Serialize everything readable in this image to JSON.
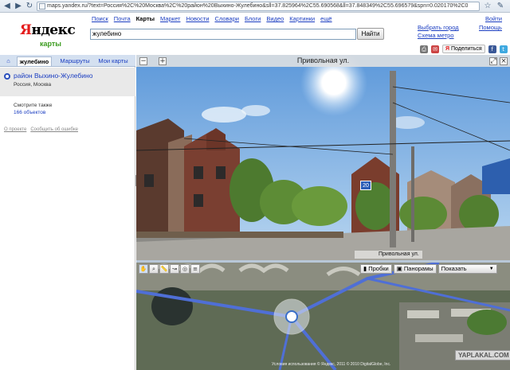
{
  "browser": {
    "url": "maps.yandex.ru/?text=Россия%2C%20Москва%2C%20район%20Выхино-Жулебино&sll=37.825964%2C55.690568&ll=37.848349%2C55.696579&spn=0.020170%2C0"
  },
  "header": {
    "logo_text_red": "Я",
    "logo_text_rest": "ндекс",
    "logo_sub": "карты",
    "services": [
      {
        "label": "Поиск",
        "active": false
      },
      {
        "label": "Почта",
        "active": false
      },
      {
        "label": "Карты",
        "active": true
      },
      {
        "label": "Маркет",
        "active": false
      },
      {
        "label": "Новости",
        "active": false
      },
      {
        "label": "Словари",
        "active": false
      },
      {
        "label": "Блоги",
        "active": false
      },
      {
        "label": "Видео",
        "active": false
      },
      {
        "label": "Картинки",
        "active": false
      },
      {
        "label": "ещё",
        "active": false
      }
    ],
    "search_value": "жулебино",
    "find_button": "Найти",
    "choose_city": "Выбрать город",
    "metro_map": "Схема метро",
    "login": "Войти",
    "help": "Помощь",
    "share_label": "Поделиться"
  },
  "left_panel": {
    "tabs": [
      {
        "label": "жулебино",
        "active": true
      },
      {
        "label": "Маршруты",
        "active": false
      },
      {
        "label": "Мои карты",
        "active": false
      }
    ],
    "result_title": "район Выхино-Жулебино",
    "result_sub": "Россия, Москва",
    "see_also": "Смотрите также",
    "objects_link": "166 объектов",
    "about_project": "О проекте",
    "report_error": "Сообщить об ошибке"
  },
  "panorama": {
    "title": "Привольная ул.",
    "street_label": "Привольная ул.",
    "house_number": "20"
  },
  "map": {
    "tools": [
      "hand",
      "zoom",
      "ruler",
      "route",
      "panorama",
      "layers"
    ],
    "traffic_button": "Пробки",
    "panoramas_button": "Панорамы",
    "show_button": "Показать",
    "copyright": "Условия использования © Яндекс, 2011 © 2010 DigitalGlobe, Inc.",
    "watermark": "YAPLAKAL.COM"
  },
  "colors": {
    "link": "#1a3dc1",
    "logo_red": "#e41b1b",
    "maps_green": "#3b9b1f",
    "road_blue": "#4f6fd6"
  }
}
